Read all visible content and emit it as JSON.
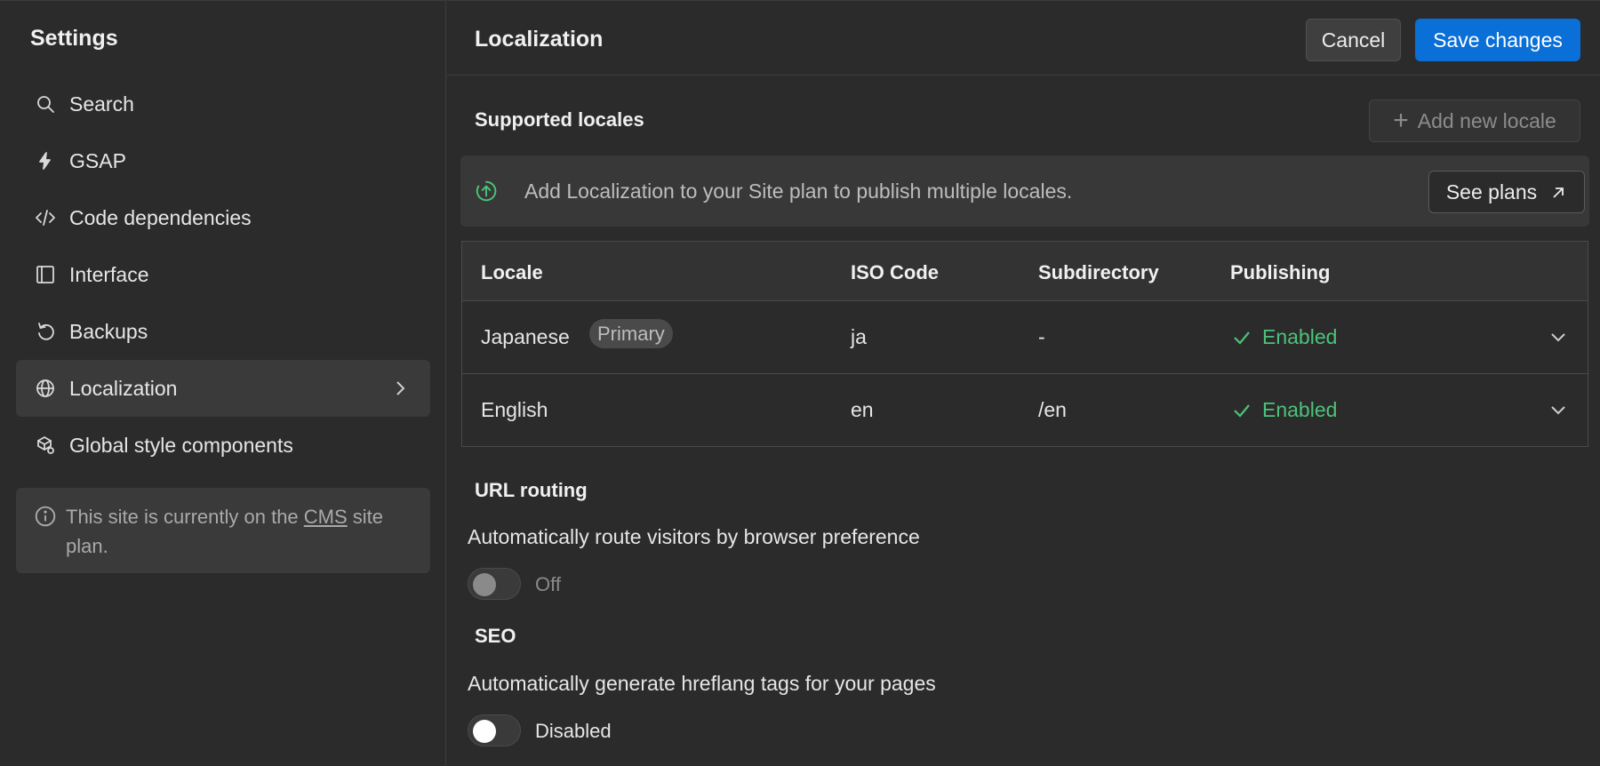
{
  "sidebar": {
    "title": "Settings",
    "items": [
      {
        "label": "Search",
        "icon": "search-icon"
      },
      {
        "label": "GSAP",
        "icon": "bolt-icon"
      },
      {
        "label": "Code dependencies",
        "icon": "code-icon"
      },
      {
        "label": "Interface",
        "icon": "layout-icon"
      },
      {
        "label": "Backups",
        "icon": "restore-icon"
      },
      {
        "label": "Localization",
        "icon": "globe-icon",
        "active": true
      },
      {
        "label": "Global style components",
        "icon": "components-icon"
      }
    ],
    "plan_notice": {
      "prefix": "This site is currently on the ",
      "plan": "CMS",
      "suffix": " site plan."
    }
  },
  "header": {
    "title": "Localization",
    "cancel_label": "Cancel",
    "save_label": "Save changes"
  },
  "locales": {
    "title": "Supported locales",
    "add_label": "Add new locale",
    "banner_text": "Add Localization to your Site plan to publish multiple locales.",
    "see_plans_label": "See plans",
    "columns": [
      "Locale",
      "ISO Code",
      "Subdirectory",
      "Publishing"
    ],
    "rows": [
      {
        "locale": "Japanese",
        "badge": "Primary",
        "iso": "ja",
        "subdir": "-",
        "publishing": "Enabled"
      },
      {
        "locale": "English",
        "badge": "",
        "iso": "en",
        "subdir": "/en",
        "publishing": "Enabled"
      }
    ]
  },
  "url_routing": {
    "title": "URL routing",
    "description": "Automatically route visitors by browser preference",
    "state": "Off"
  },
  "seo": {
    "title": "SEO",
    "description": "Automatically generate hreflang tags for your pages",
    "state": "Disabled"
  },
  "colors": {
    "accent": "#0a6fd6",
    "success": "#4cc27a",
    "background": "#2b2b2b"
  }
}
